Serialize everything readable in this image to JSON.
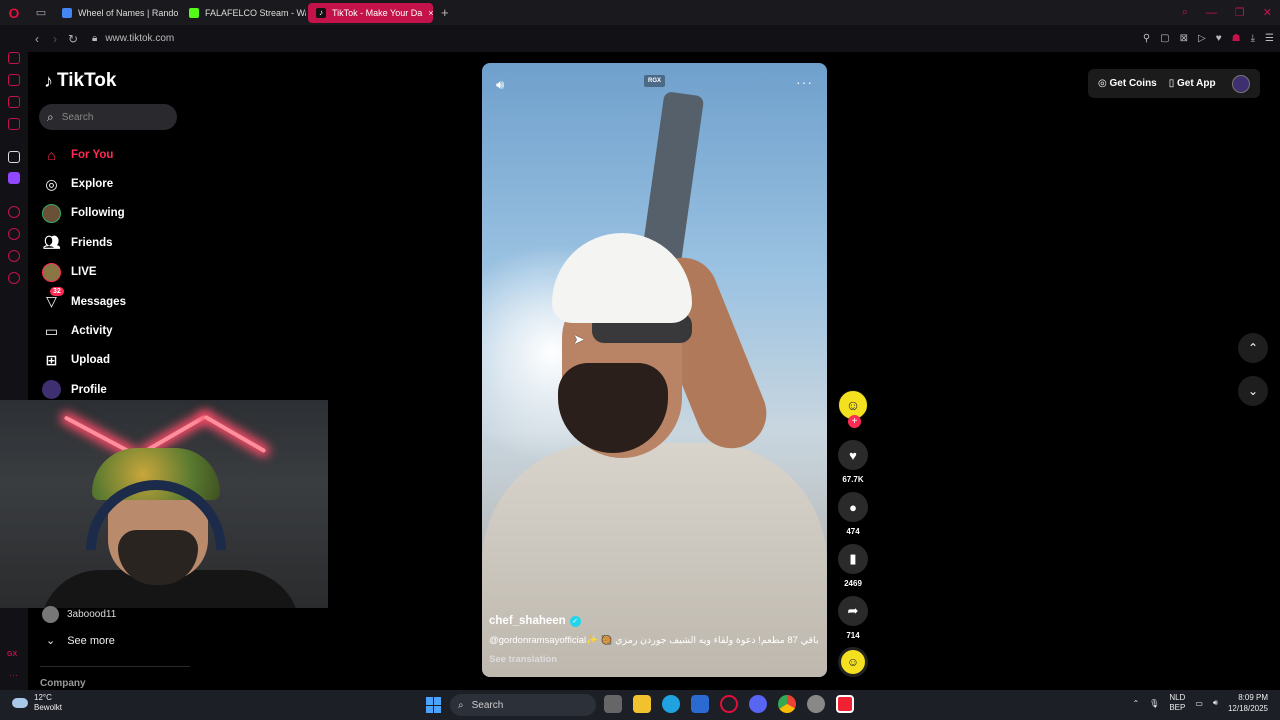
{
  "browser": {
    "tabs": [
      {
        "label": "Wheel of Names | Rando",
        "color": "#4285f4",
        "active": false
      },
      {
        "label": "FALAFELCO Stream - Wa",
        "color": "#53fc18",
        "active": false
      },
      {
        "label": "TikTok - Make Your Da",
        "color": "#ffffff",
        "active": true
      }
    ],
    "url": "www.tiktok.com",
    "accent": "#c4124a"
  },
  "tiktok": {
    "logo": "TikTok",
    "search_placeholder": "Search",
    "nav": [
      {
        "label": "For You",
        "icon": "home-icon",
        "active": true
      },
      {
        "label": "Explore",
        "icon": "compass-icon"
      },
      {
        "label": "Following",
        "icon": "following-avatar"
      },
      {
        "label": "Friends",
        "icon": "friends-icon"
      },
      {
        "label": "LIVE",
        "icon": "live-avatar"
      },
      {
        "label": "Messages",
        "icon": "messages-icon",
        "badge": "32"
      },
      {
        "label": "Activity",
        "icon": "activity-icon"
      },
      {
        "label": "Upload",
        "icon": "upload-icon"
      },
      {
        "label": "Profile",
        "icon": "profile-avatar"
      }
    ],
    "following_account": "3aboood11",
    "see_more": "See more",
    "company": "Company",
    "get_coins": "Get Coins",
    "get_app": "Get App",
    "brand_color": "#fe2c55"
  },
  "video": {
    "tag": "RGX",
    "username": "chef_shaheen",
    "description": "@gordonramsayofficial✨ 🥘 باقي 87 مطعم! دعوة ولقاء ويه الشيف جوردن رمزي",
    "see_translation": "See translation",
    "likes": "67.7K",
    "comments": "474",
    "saves": "2469",
    "shares": "714"
  },
  "taskbar": {
    "temp": "12°C",
    "weather": "Bewolkt",
    "search": "Search",
    "lang_top": "NLD",
    "lang_bottom": "BEP",
    "time": "8:09 PM",
    "date": "12/18/2025"
  }
}
